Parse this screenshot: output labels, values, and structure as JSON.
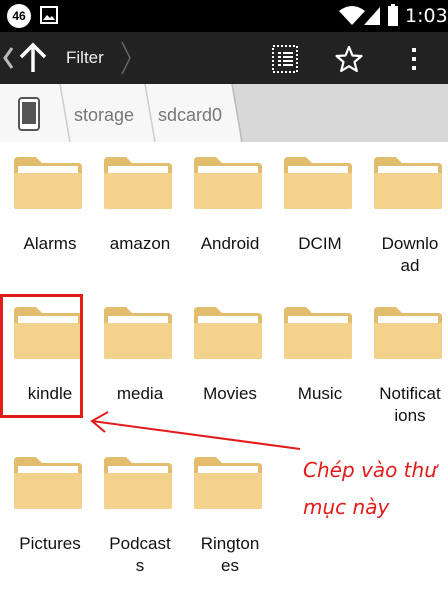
{
  "status_bar": {
    "network_badge": "46",
    "time": "1:03"
  },
  "toolbar": {
    "title": "Filter"
  },
  "breadcrumb": {
    "items": [
      "storage",
      "sdcard0"
    ]
  },
  "folders": [
    {
      "name": "Alarms"
    },
    {
      "name": "amazon"
    },
    {
      "name": "Android"
    },
    {
      "name": "DCIM"
    },
    {
      "name": "Downlo\nad"
    },
    {
      "name": "kindle"
    },
    {
      "name": "media"
    },
    {
      "name": "Movies"
    },
    {
      "name": "Music"
    },
    {
      "name": "Notificat\nions"
    },
    {
      "name": "Pictures"
    },
    {
      "name": "Podcast\ns"
    },
    {
      "name": "Rington\nes"
    }
  ],
  "annotation": {
    "text": "Chép vào thư mục này",
    "color": "#e21b1b"
  },
  "colors": {
    "folder": "#f2d28c",
    "folder_dark": "#e3bd6e",
    "action_bar": "#222222",
    "breadcrumb": "#e8e8e8"
  }
}
